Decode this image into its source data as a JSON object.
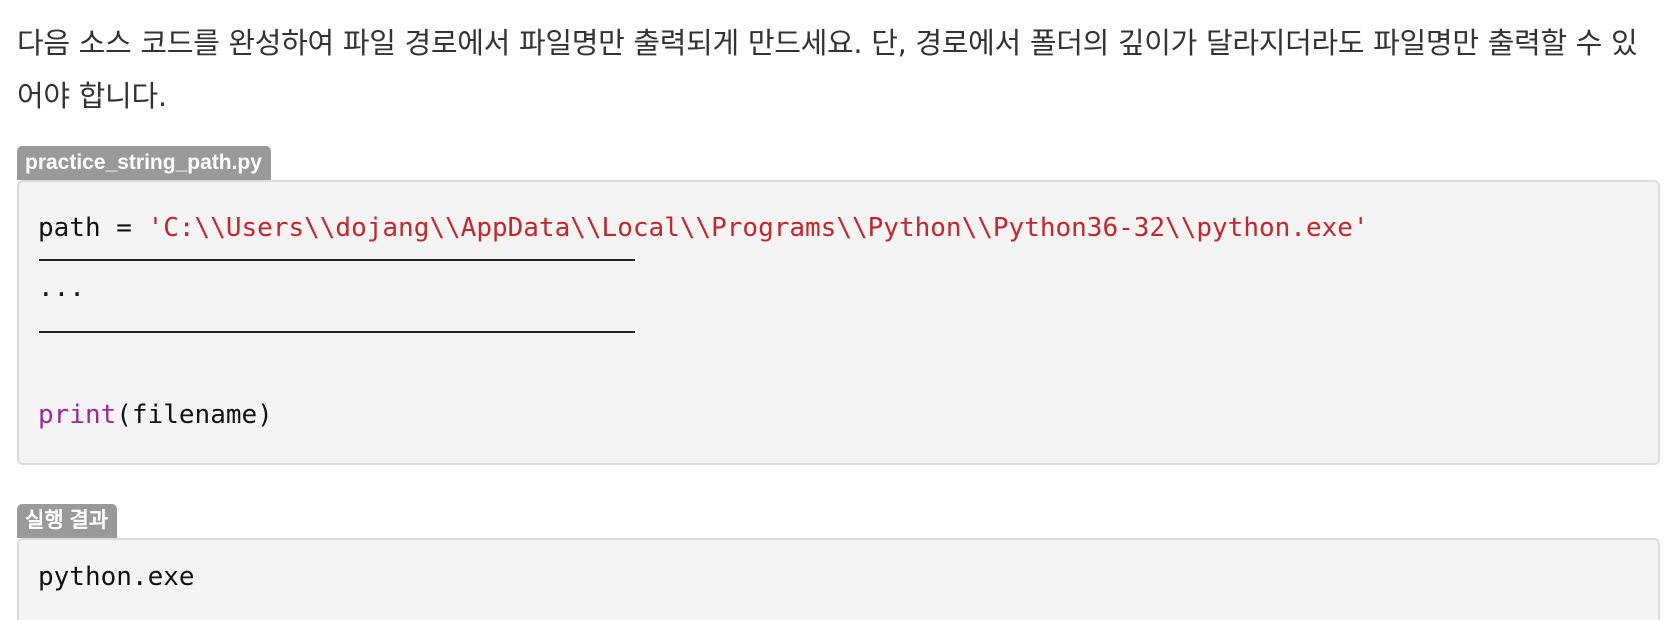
{
  "question": {
    "text": "다음 소스 코드를 완성하여 파일 경로에서 파일명만 출력되게 만드세요. 단, 경로에서 폴더의 깊이가 달라지더라도 파일명만 출력할 수 있어야 합니다."
  },
  "code_block": {
    "filename": "practice_string_path.py",
    "line1": {
      "var": "path",
      "op": " = ",
      "string": "'C:\\\\Users\\\\dojang\\\\AppData\\\\Local\\\\Programs\\\\Python\\\\Python36-32\\\\python.exe'"
    },
    "ellipsis": "...",
    "print_line": {
      "func": "print",
      "args": "(filename)"
    }
  },
  "result_block": {
    "label": "실행 결과",
    "output": "python.exe"
  }
}
